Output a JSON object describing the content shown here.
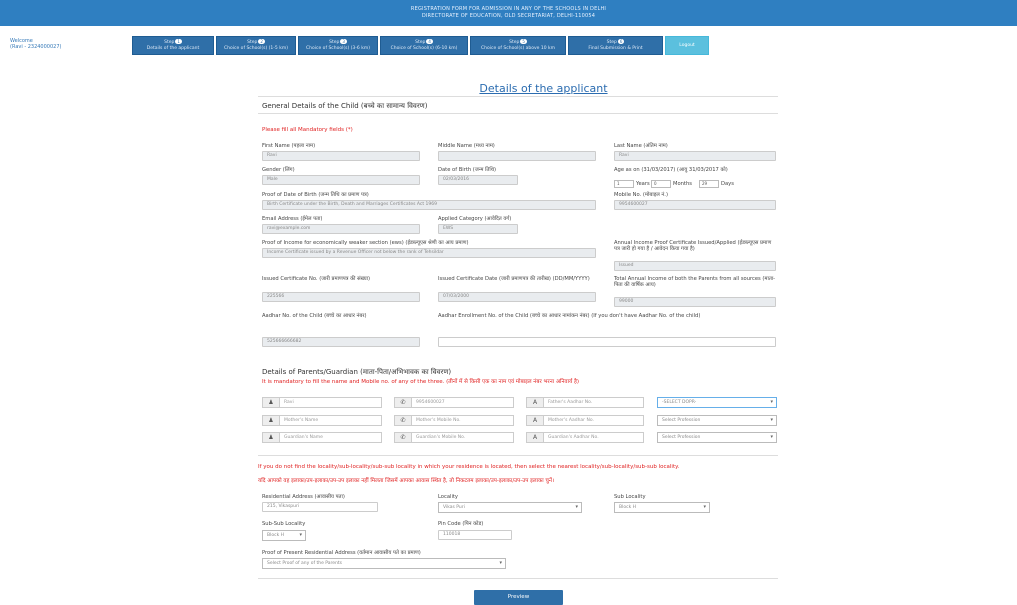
{
  "header": {
    "line1": "REGISTRATION FORM FOR ADMISSION IN ANY OF THE SCHOOLS IN DELHI",
    "line2": "DIRECTORATE OF EDUCATION, OLD SECRETARIAT, DELHI-110054"
  },
  "welcome": {
    "label": "Welcome",
    "user": "(Ravi - 2324000027)"
  },
  "steps": [
    {
      "step": "Step",
      "num": "1",
      "label": "Details of the applicant"
    },
    {
      "step": "Step",
      "num": "2",
      "label": "Choice of School(s) (1-5 km)"
    },
    {
      "step": "Step",
      "num": "3",
      "label": "Choice of School(s) (3-6 km)"
    },
    {
      "step": "Step",
      "num": "4",
      "label": "Choice of School(s) (6-10 km)"
    },
    {
      "step": "Step",
      "num": "5",
      "label": "Choice of School(s) above 10 km"
    },
    {
      "step": "Step",
      "num": "6",
      "label": "Final Submission & Print"
    }
  ],
  "logout": "Logout",
  "page_title": "Details of the applicant",
  "general": {
    "heading": "General Details of the Child (बच्चे का सामान्य विवरण)",
    "mandatory": "Please fill all Mandatory fields (*)"
  },
  "fields": {
    "first_name": {
      "label": "First Name (पहला नाम)",
      "value": "Ravi"
    },
    "middle_name": {
      "label": "Middle Name (मध्य नाम)",
      "value": ""
    },
    "last_name": {
      "label": "Last Name (अंतिम नाम)",
      "value": "Ravi"
    },
    "gender": {
      "label": "Gender (लिंग)",
      "value": "Male"
    },
    "dob": {
      "label": "Date of Birth (जन्म तिथि)",
      "value": "02/03/2016"
    },
    "age": {
      "label": "Age as on (31/03/2017) (आयु 31/03/2017 को)",
      "years": "1",
      "y_unit": "Years",
      "months": "0",
      "m_unit": "Months",
      "days": "29",
      "d_unit": "Days"
    },
    "proof_dob": {
      "label": "Proof of Date of Birth (जन्म तिथि का प्रमाण पत्र)",
      "value": "Birth Certificate under the Birth, Death and Marriages Certificates Act 1969"
    },
    "mobile": {
      "label": "Mobile No. (मोबाइल नं.)",
      "value": "9954600027"
    },
    "email": {
      "label": "Email Address (ईमेल पता)",
      "value": "ravi@example.com"
    },
    "category": {
      "label": "Applied Category (आवेदित वर्ग)",
      "value": "EWS"
    },
    "proof_income": {
      "label": "Proof of Income for economically weaker section (ews) (ईडब्ल्यूएस श्रेणी का आय प्रमाण)",
      "value": "Income Certificate issued by a Revenue Officer not below the rank of Tehsildar"
    },
    "annual_proof": {
      "label": "Annual Income Proof Certificate Issued/Applied (ईडब्ल्यूएस प्रमाण पत्र जारी हो गया है / आवेदन किया गया है)",
      "value": "Issued"
    },
    "cert_no": {
      "label": "Issued Certificate No. (जारी प्रमाणपत्र की संख्या)",
      "value": "225566"
    },
    "cert_date": {
      "label": "Issued Certificate Date (जारी प्रमाणपत्र की तारीख) (DD/MM/YYYY)",
      "value": "07/03/2000"
    },
    "total_income": {
      "label": "Total Annual Income of both the Parents from all sources (माता-पिता की वार्षिक आय)",
      "value": "99000"
    },
    "aadhar": {
      "label": "Aadhar No. of the Child (बच्चे का आधार नंबर)",
      "value": "525666666682"
    },
    "aadhar_enroll": {
      "label": "Aadhar Enrollment No. of the Child (बच्चे का आधार नामांकन नंबर) (If you don't have Aadhar No. of the child)",
      "value": ""
    }
  },
  "parents": {
    "heading": "Details of Parents/Guardian (माता-पिता/अभिभावक का विवरण)",
    "note": "It is mandatory to fill the name and Mobile no. of any of the three. (तीनों में से किसी एक का नाम एवं मोबाइल नंबर भरना अनिवार्य है)",
    "rows": [
      {
        "name": "Ravi",
        "mobile": "9954600027",
        "aadhar": "Father's Aadhar No.",
        "profession": "-SELECT DOPR-"
      },
      {
        "name": "Mother's Name",
        "mobile": "Mother's Mobile No.",
        "aadhar": "Mother's Aadhar No.",
        "profession": "Select Profession"
      },
      {
        "name": "Guardian's Name",
        "mobile": "Guardian's Mobile No.",
        "aadhar": "Guardian's Aadhar No.",
        "profession": "Select Profession"
      }
    ]
  },
  "locality_note": {
    "en": "If you do not find the locality/sub-locality/sub-sub locality in which your residence is located, then select the nearest locality/sub-locality/sub-sub locality.",
    "hi": "यदि आपको वह इलाका/उप-इलाका/उप-उप इलाका नहीं मिलता जिसमें आपका आवास स्थित है, तो निकटतम इलाका/उप-इलाका/उप-उप इलाका चुनें।"
  },
  "address": {
    "residential": {
      "label": "Residential Address (आवासीय पता)",
      "value": "215, Vikaspuri"
    },
    "locality": {
      "label": "Locality",
      "value": "Vikas Puri"
    },
    "sub_locality": {
      "label": "Sub Locality",
      "value": "Block H"
    },
    "sub_sub_locality": {
      "label": "Sub-Sub Locality",
      "value": "Block H"
    },
    "pin": {
      "label": "Pin Code (पिन कोड)",
      "value": "110018"
    },
    "proof": {
      "label": "Proof of Present Residential Address (वर्तमान आवासीय पते का प्रमाण)",
      "value": "Select Proof of any of the Parents"
    }
  },
  "submit": "Preview"
}
